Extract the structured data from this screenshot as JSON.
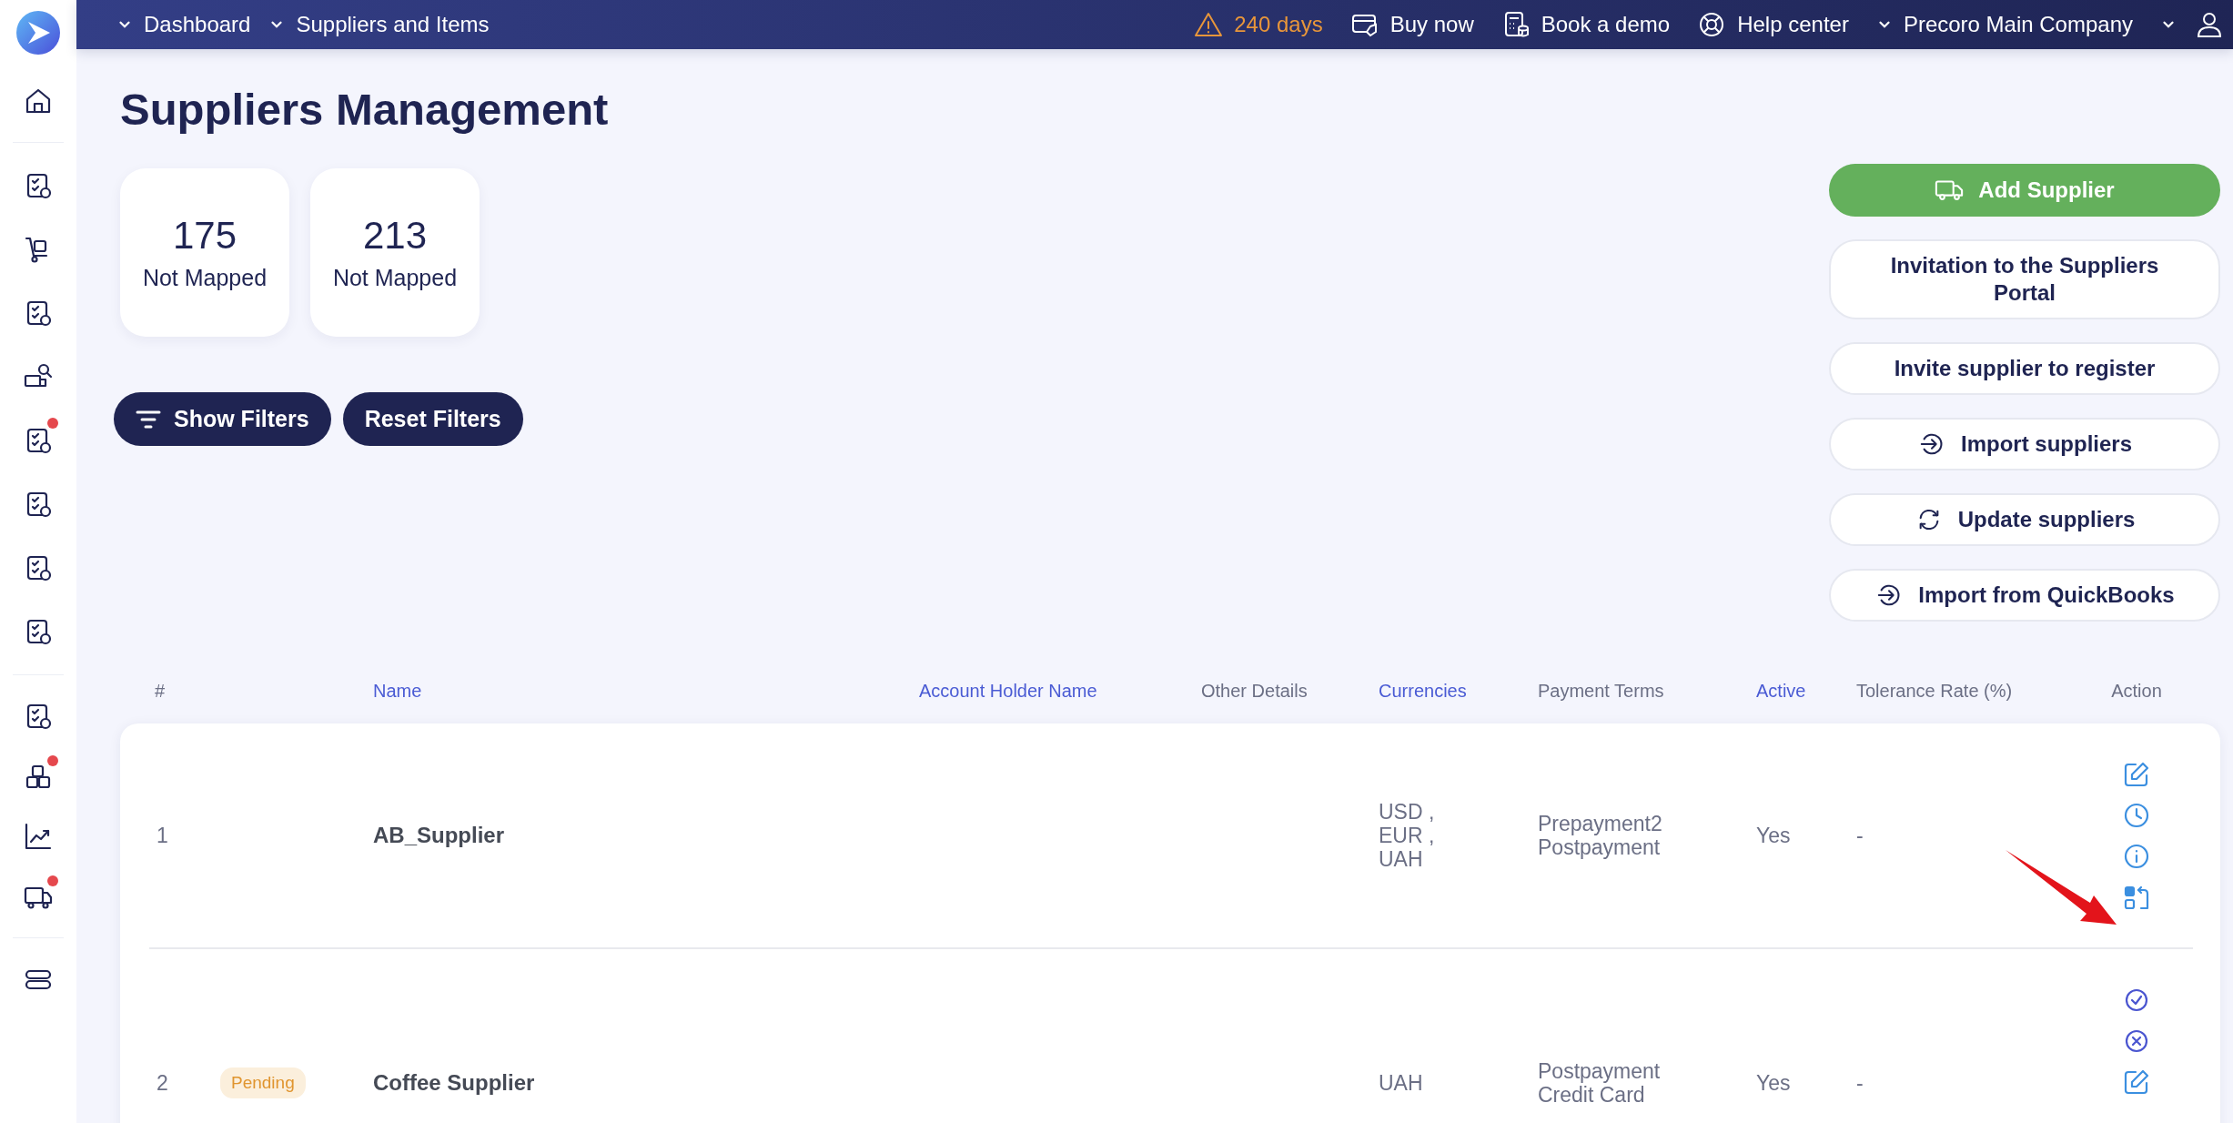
{
  "topbar": {
    "nav": [
      {
        "label": "Dashboard"
      },
      {
        "label": "Suppliers and Items"
      }
    ],
    "trial": "240 days",
    "links": [
      {
        "label": "Buy now",
        "kind": "card"
      },
      {
        "label": "Book a demo",
        "kind": "calculator"
      },
      {
        "label": "Help center",
        "kind": "lifebuoy"
      }
    ],
    "company": "Precoro Main Company"
  },
  "sidebar": {
    "groups": [
      [
        {
          "badge": false
        }
      ],
      [
        {
          "badge": false
        },
        {
          "badge": false
        },
        {
          "badge": false
        },
        {
          "badge": false
        },
        {
          "badge": true
        },
        {
          "badge": false
        },
        {
          "badge": false
        },
        {
          "badge": false
        }
      ],
      [
        {
          "badge": false
        },
        {
          "badge": true
        },
        {
          "badge": false
        },
        {
          "badge": true
        }
      ],
      [
        {
          "badge": false
        }
      ]
    ]
  },
  "title": "Suppliers Management",
  "stats": [
    {
      "value": "175",
      "label": "Not Mapped"
    },
    {
      "value": "213",
      "label": "Not Mapped"
    }
  ],
  "filters": [
    {
      "label": "Show Filters",
      "kind": "show"
    },
    {
      "label": "Reset Filters",
      "kind": "reset"
    }
  ],
  "actions": [
    {
      "label": "Add Supplier",
      "kind": "primary"
    },
    {
      "label": "Invitation to the Suppliers Portal",
      "kind": "plain"
    },
    {
      "label": "Invite supplier to register",
      "kind": "plain"
    },
    {
      "label": "Import suppliers",
      "kind": "import"
    },
    {
      "label": "Update suppliers",
      "kind": "update"
    },
    {
      "label": "Import from QuickBooks",
      "kind": "import"
    }
  ],
  "table": {
    "columns": [
      {
        "label": "#",
        "sortable": false
      },
      {
        "label": "Name",
        "sortable": true
      },
      {
        "label": "Account Holder Name",
        "sortable": true
      },
      {
        "label": "Other Details",
        "sortable": false
      },
      {
        "label": "Currencies",
        "sortable": true
      },
      {
        "label": "Payment Terms",
        "sortable": false
      },
      {
        "label": "Active",
        "sortable": true
      },
      {
        "label": "Tolerance Rate (%)",
        "sortable": false
      },
      {
        "label": "Action",
        "sortable": false
      }
    ],
    "rows": [
      {
        "number": "1",
        "name": "AB_Supplier",
        "currencies": [
          "USD ,",
          "EUR ,",
          "UAH"
        ],
        "payment_terms": [
          "Prepayment2",
          "Postpayment"
        ],
        "active": "Yes",
        "tolerance": "-",
        "actions": [
          {
            "kind": "edit"
          },
          {
            "kind": "history"
          },
          {
            "kind": "info"
          },
          {
            "kind": "map"
          }
        ]
      },
      {
        "number": "2",
        "status": "Pending",
        "name": "Coffee Supplier",
        "currencies": [
          "UAH"
        ],
        "payment_terms": [
          "Postpayment",
          "Credit Card"
        ],
        "active": "Yes",
        "tolerance": "-",
        "actions": [
          {
            "kind": "approve"
          },
          {
            "kind": "reject"
          },
          {
            "kind": "edit"
          }
        ]
      }
    ]
  },
  "annotation": {
    "kind": "arrow"
  }
}
